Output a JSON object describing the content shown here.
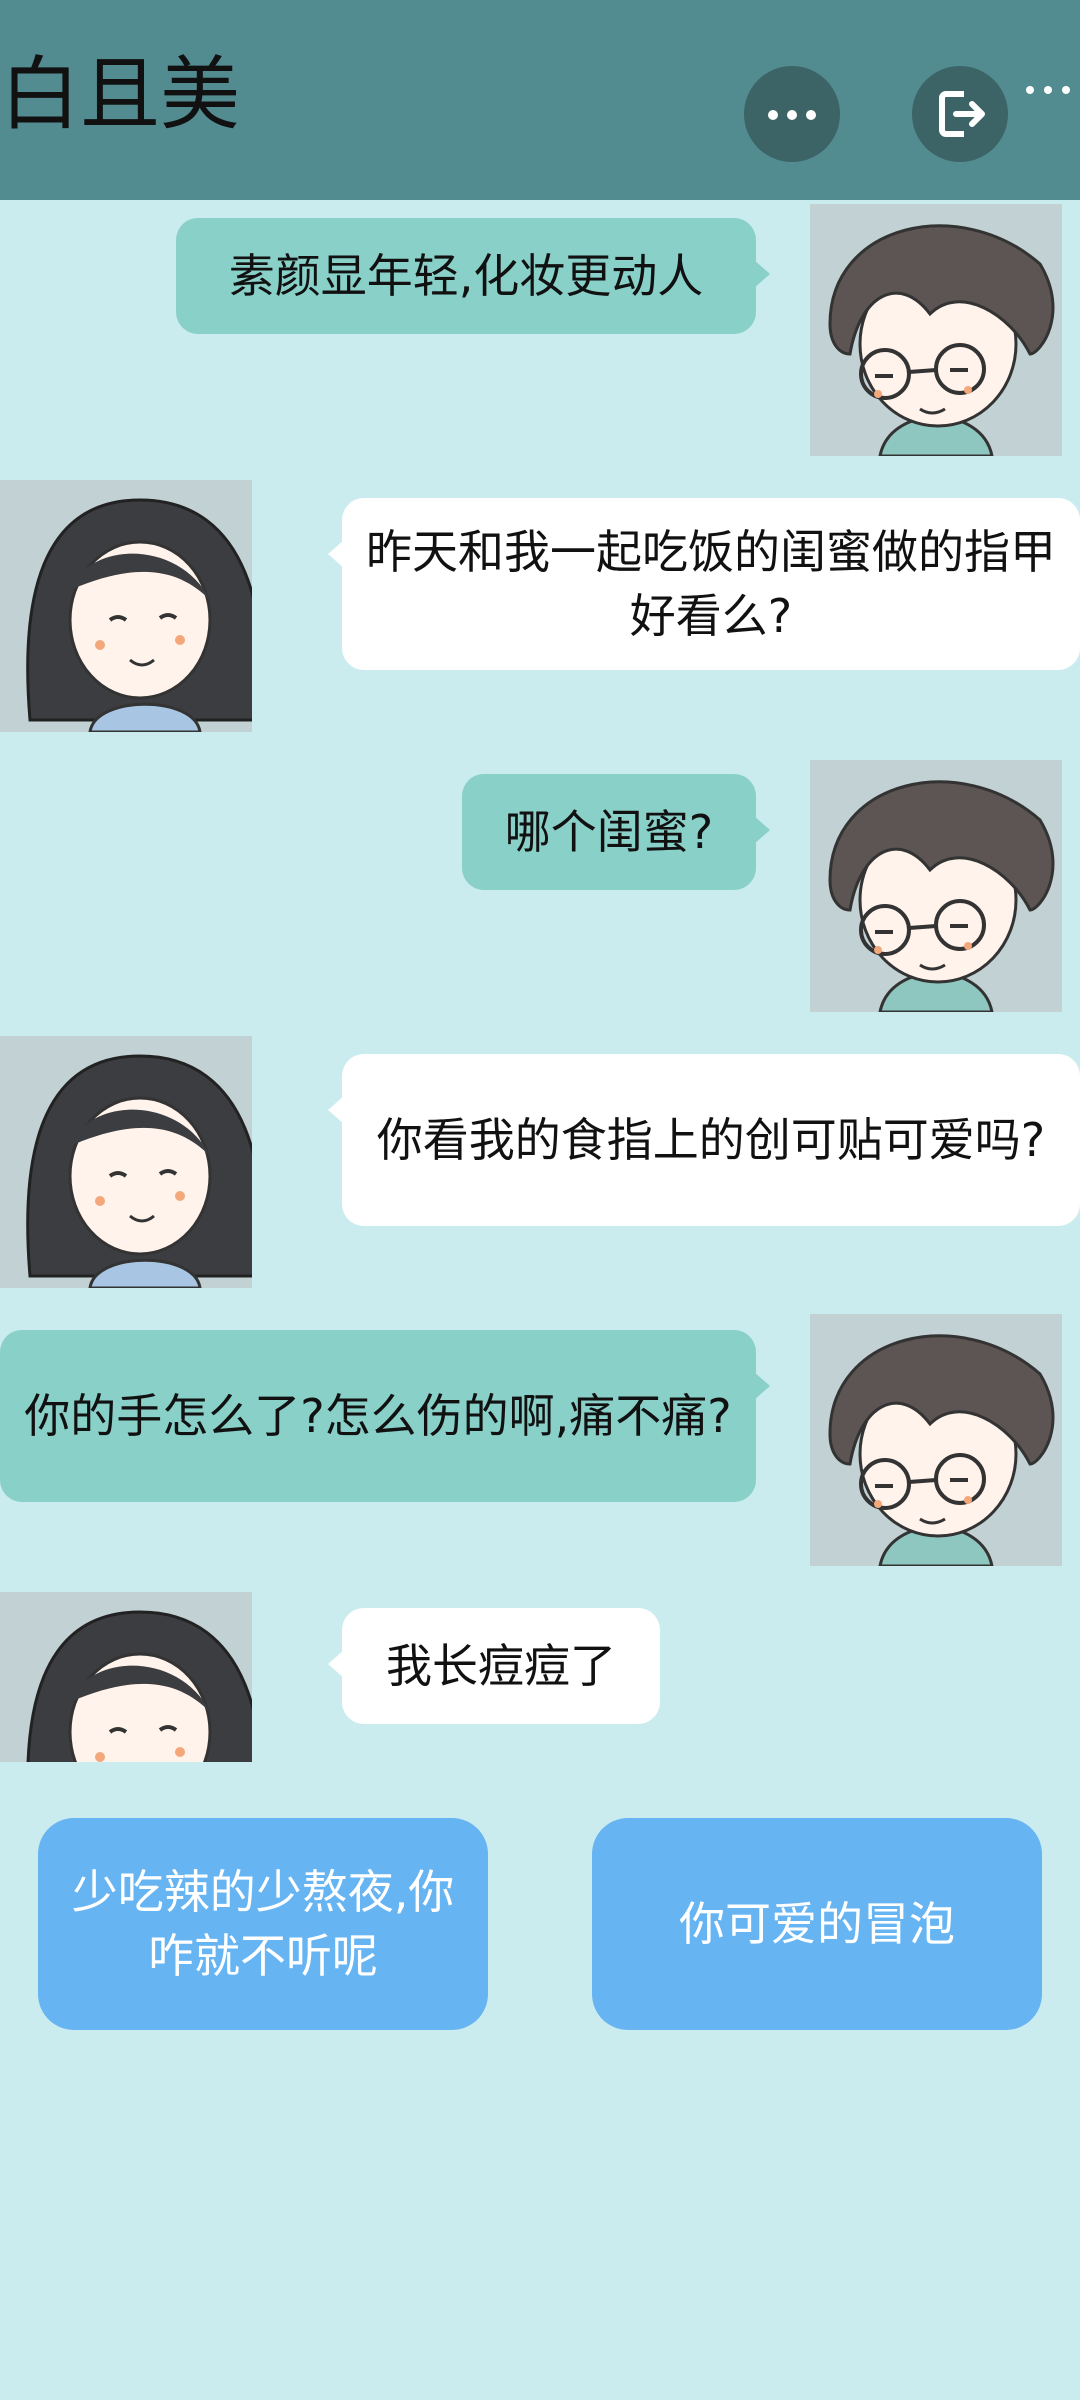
{
  "header": {
    "title": "白且美"
  },
  "messages": [
    {
      "side": "me",
      "text": "素颜显年轻,化妆更动人"
    },
    {
      "side": "them",
      "text": "昨天和我一起吃饭的闺蜜做的指甲好看么?"
    },
    {
      "side": "me",
      "text": "哪个闺蜜?"
    },
    {
      "side": "them",
      "text": "你看我的食指上的创可贴可爱吗?"
    },
    {
      "side": "me",
      "text": "你的手怎么了?怎么伤的啊,痛不痛?"
    },
    {
      "side": "them",
      "text": "我长痘痘了"
    }
  ],
  "choices": [
    {
      "label": "少吃辣的少熬夜,你咋就不听呢"
    },
    {
      "label": "你可爱的冒泡"
    }
  ],
  "colors": {
    "background": "#cbecee",
    "header": "#528b90",
    "my_bubble": "#89d0c9",
    "their_bubble": "#ffffff",
    "choice_button": "#67b4f3"
  },
  "icons": [
    "more-icon",
    "exit-icon",
    "overflow-icon"
  ]
}
